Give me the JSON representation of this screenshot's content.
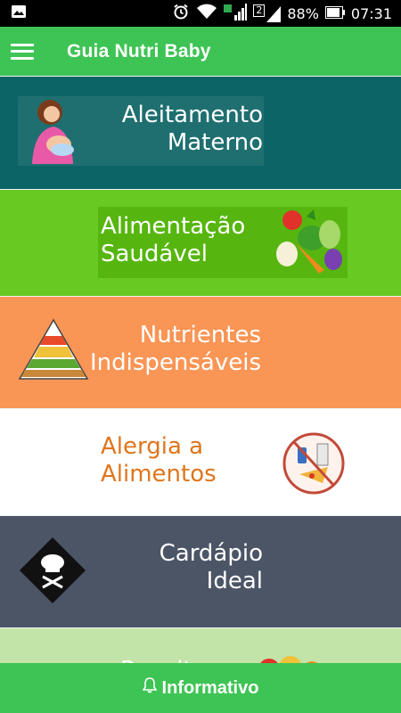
{
  "status_bar": {
    "battery": "88%",
    "time": "07:31",
    "sim_slot": "2"
  },
  "app_bar": {
    "title": "Guia Nutri Baby"
  },
  "banners": [
    {
      "line1": "Aleitamento",
      "line2": "Materno",
      "color": "#0d6467"
    },
    {
      "line1": "Alimentação",
      "line2": "Saudável",
      "color": "#68c922"
    },
    {
      "line1": "Nutrientes",
      "line2": "Indispensáveis",
      "color": "#f99555"
    },
    {
      "line1": "Alergia a",
      "line2": "Alimentos",
      "color": "#ffffff"
    },
    {
      "line1": "Cardápio",
      "line2": "Ideal",
      "color": "#4b5566"
    },
    {
      "line1": "Receitas",
      "line2": "",
      "color": "#c3e4a8"
    }
  ],
  "bottom_bar": {
    "label": "Informativo",
    "icon": "bell-icon",
    "color": "#3ec454"
  }
}
